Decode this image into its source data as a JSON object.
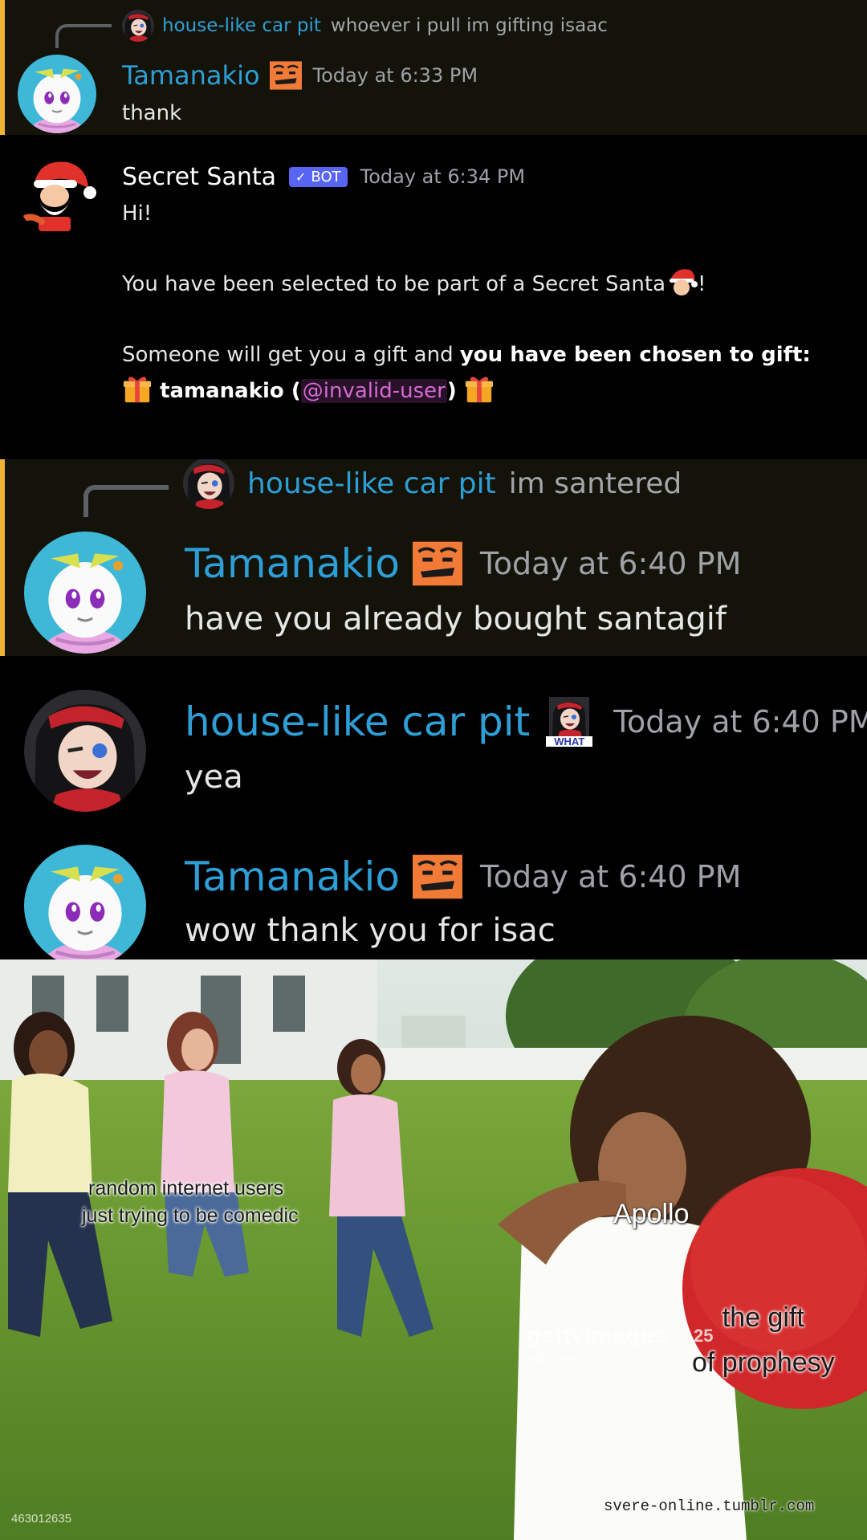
{
  "messages": [
    {
      "reply": {
        "name": "house-like car pit",
        "text": "whoever i pull im gifting isaac"
      },
      "author": "Tamanakio",
      "timestamp": "Today at 6:33 PM",
      "text": "thank"
    },
    {
      "author": "Secret Santa",
      "bot_label": "BOT",
      "timestamp": "Today at 6:34 PM",
      "lines": {
        "greeting": "Hi!",
        "selected": "You have been selected to be part of a Secret Santa",
        "selected_end": "!",
        "someone": "Someone will get you a gift and ",
        "chosen": "you have been chosen to gift:",
        "recipient": "tamanakio (",
        "mention": "@invalid-user",
        "recipient_end": ")"
      }
    },
    {
      "reply": {
        "name": "house-like car pit",
        "text": "im santered"
      },
      "author": "Tamanakio",
      "timestamp": "Today at 6:40 PM",
      "text": "have you already bought santagif"
    },
    {
      "author": "house-like car pit",
      "badge_text": "WHAT",
      "timestamp": "Today at 6:40 PM",
      "text": "yea"
    },
    {
      "author": "Tamanakio",
      "timestamp": "Today at 6:40 PM",
      "text": "wow thank you for isac"
    }
  ],
  "meme": {
    "label_left_1": "random internet users",
    "label_left_2": "just trying to be comedic",
    "label_apollo": "Apollo",
    "label_gift_1": "the gift",
    "label_gift_2": "of prophesy",
    "watermark_getty": "gettyimages",
    "watermark_credit": "Hill Street Studios",
    "watermark_years": "25",
    "image_id": "463012635",
    "source": "svere-online.tumblr.com"
  },
  "colors": {
    "username": "#2e9fd6",
    "highlight_bar": "#f0b232",
    "bot_tag": "#5865f2",
    "mention": "#d36bd1"
  }
}
